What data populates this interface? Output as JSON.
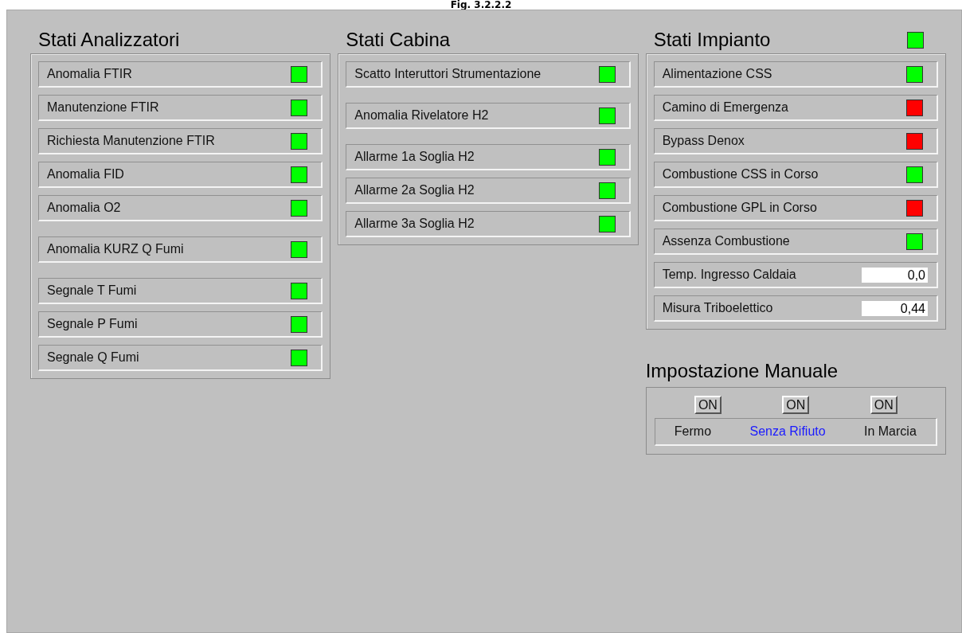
{
  "caption": "Fig. 3.2.2.2",
  "sections": [
    {
      "title": "Stati Analizzatori",
      "groups": [
        [
          {
            "kind": "lamp",
            "label": "Anomalia FTIR",
            "color": "#00ff00"
          },
          {
            "kind": "lamp",
            "label": "Manutenzione FTIR",
            "color": "#00ff00"
          },
          {
            "kind": "lamp",
            "label": "Richiesta Manutenzione FTIR",
            "color": "#00ff00"
          },
          {
            "kind": "lamp",
            "label": "Anomalia FID",
            "color": "#00ff00"
          },
          {
            "kind": "lamp",
            "label": "Anomalia O2",
            "color": "#00ff00"
          }
        ],
        [
          {
            "kind": "lamp",
            "label": "Anomalia KURZ Q Fumi",
            "color": "#00ff00"
          }
        ],
        [
          {
            "kind": "lamp",
            "label": "Segnale T Fumi",
            "color": "#00ff00"
          },
          {
            "kind": "lamp",
            "label": "Segnale P Fumi",
            "color": "#00ff00"
          },
          {
            "kind": "lamp",
            "label": "Segnale Q Fumi",
            "color": "#00ff00"
          }
        ]
      ]
    },
    {
      "title": "Stati Cabina",
      "groups": [
        [
          {
            "kind": "lamp",
            "label": "Scatto Interuttori Strumentazione",
            "color": "#00ff00"
          }
        ],
        [
          {
            "kind": "lamp",
            "label": "Anomalia Rivelatore H2",
            "color": "#00ff00"
          }
        ],
        [
          {
            "kind": "lamp",
            "label": "Allarme 1a Soglia H2",
            "color": "#00ff00"
          },
          {
            "kind": "lamp",
            "label": "Allarme 2a Soglia H2",
            "color": "#00ff00"
          },
          {
            "kind": "lamp",
            "label": "Allarme 3a Soglia H2",
            "color": "#00ff00"
          }
        ]
      ]
    },
    {
      "title": "Stati Impianto",
      "color": "#00ff00",
      "groups": [
        [
          {
            "kind": "lamp",
            "label": "Alimentazione CSS",
            "color": "#00ff00"
          },
          {
            "kind": "lamp",
            "label": "Camino di Emergenza",
            "color": "#ff0000"
          },
          {
            "kind": "lamp",
            "label": "Bypass Denox",
            "color": "#ff0000"
          },
          {
            "kind": "lamp",
            "label": "Combustione CSS in Corso",
            "color": "#00ff00"
          },
          {
            "kind": "lamp",
            "label": "Combustione GPL in Corso",
            "color": "#ff0000"
          },
          {
            "kind": "lamp",
            "label": "Assenza Combustione",
            "color": "#00ff00"
          },
          {
            "kind": "value",
            "label": "Temp. Ingresso Caldaia",
            "value": "0,0"
          },
          {
            "kind": "value",
            "label": "Misura Triboelettico",
            "value": "0,44"
          }
        ]
      ]
    }
  ],
  "manual": {
    "title": "Impostazione Manuale",
    "modes": [
      {
        "button": "ON",
        "label": "Fermo",
        "selected": false
      },
      {
        "button": "ON",
        "label": "Senza Rifiuto",
        "selected": true
      },
      {
        "button": "ON",
        "label": "In Marcia",
        "selected": false
      }
    ]
  }
}
